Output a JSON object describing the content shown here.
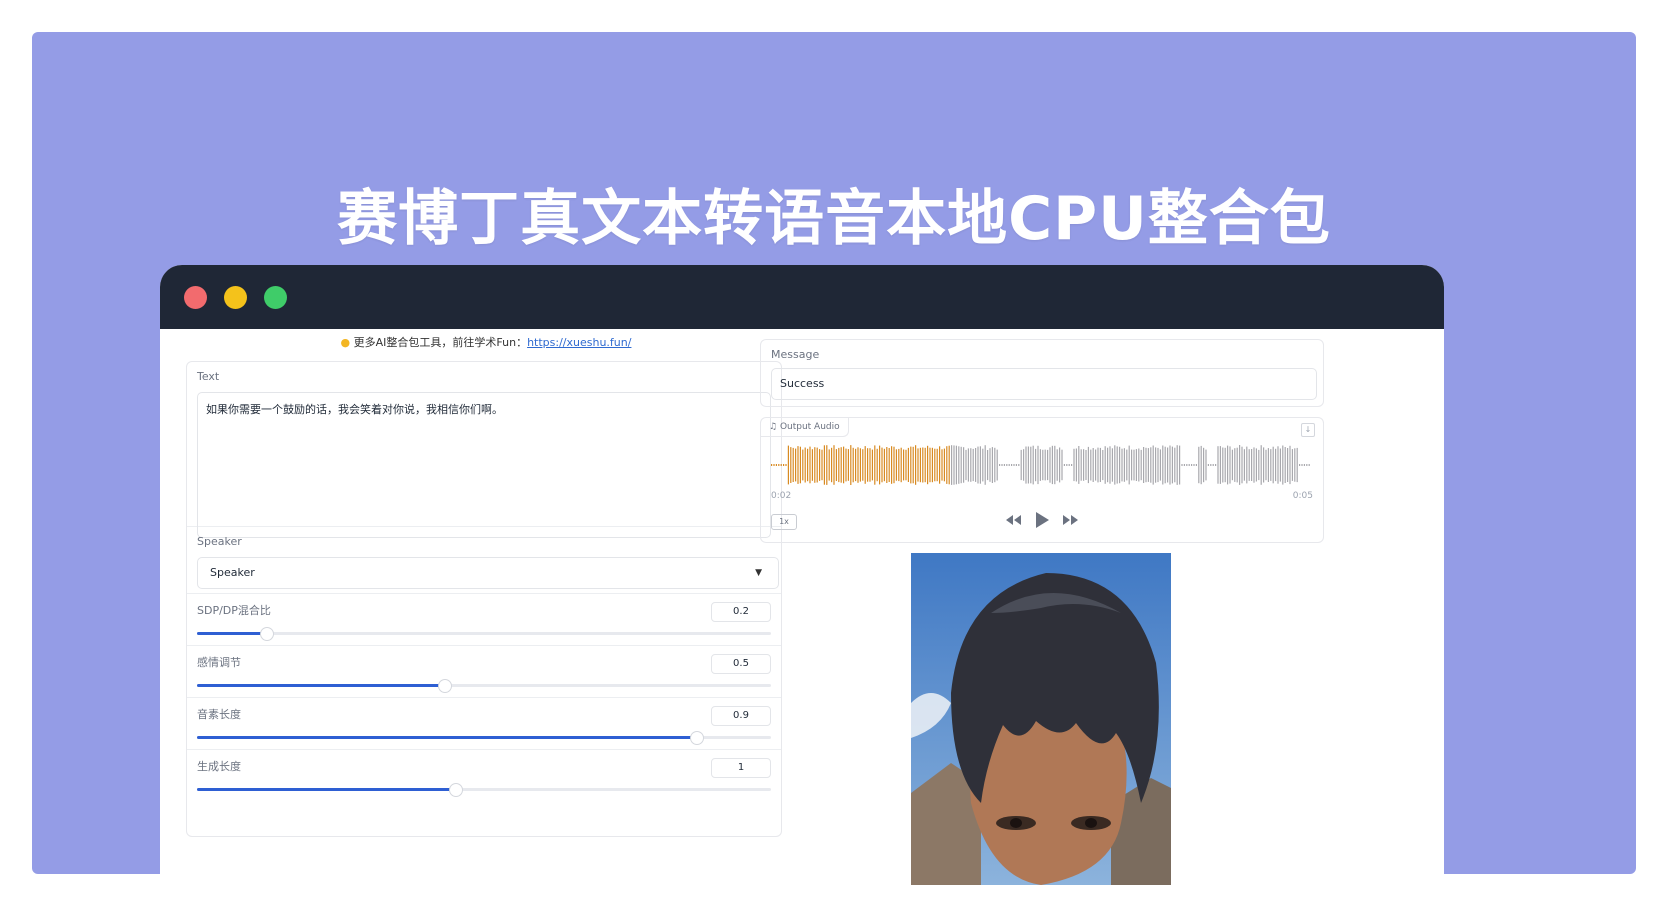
{
  "headline": "赛博丁真文本转语音本地CPU整合包",
  "notice": {
    "icon": "lightbulb-icon",
    "text": "更多AI整合包工具，前往学术Fun：",
    "link": "https://xueshu.fun/"
  },
  "left": {
    "text_label": "Text",
    "text_value": "如果你需要一个鼓励的话，我会笑着对你说，我相信你们啊。",
    "speaker_label": "Speaker",
    "speaker_value": "Speaker",
    "sliders": [
      {
        "label": "SDP/DP混合比",
        "value": "0.2",
        "fraction": 0.12
      },
      {
        "label": "感情调节",
        "value": "0.5",
        "fraction": 0.43
      },
      {
        "label": "音素长度",
        "value": "0.9",
        "fraction": 0.87
      },
      {
        "label": "生成长度",
        "value": "1",
        "fraction": 0.45
      }
    ]
  },
  "right": {
    "message_label": "Message",
    "message_value": "Success",
    "audio_label": "Output Audio",
    "audio_current": "0:02",
    "audio_total": "0:05",
    "playback_progress": 0.33,
    "speed": "1x"
  },
  "colors": {
    "banner": "#949ce6",
    "titlebar": "#1f2736",
    "wave_played": "#d88a22",
    "wave_rest": "#a8a8ad",
    "slider_fill": "#2e5fd3"
  }
}
